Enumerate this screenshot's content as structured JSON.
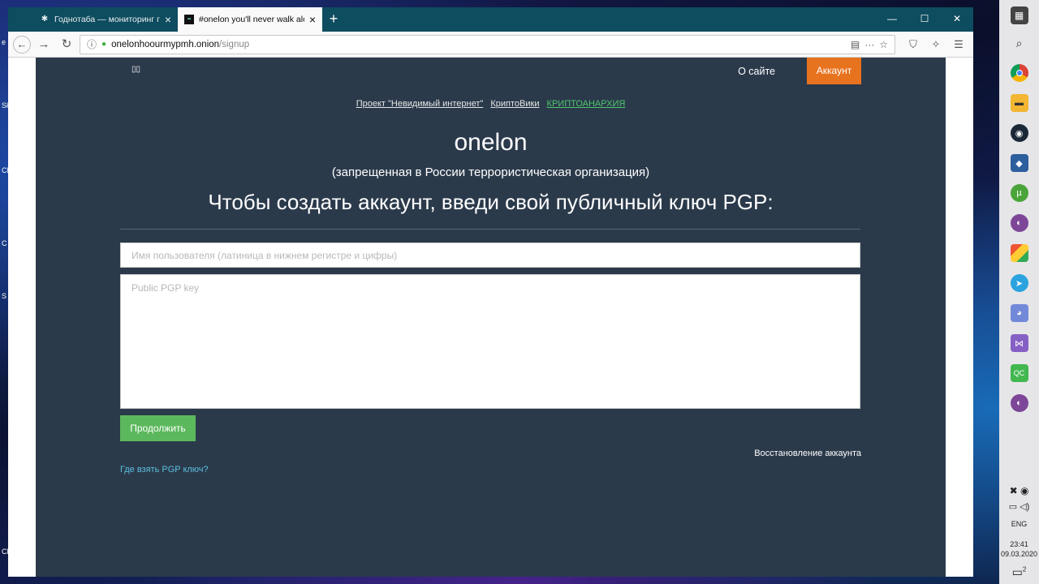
{
  "desktop": {
    "labels": [
      "e",
      "Sk",
      "Cl",
      "C",
      "S",
      "Cl"
    ]
  },
  "browser": {
    "tabs": [
      {
        "title": "Годнотаба — мониторинг год",
        "active": false
      },
      {
        "title": "#onelon you'll never walk alone",
        "active": true
      }
    ],
    "new_tab": "+",
    "window_controls": {
      "minimize": "—",
      "maximize": "☐",
      "close": "✕"
    },
    "url_host": "onelonhoourmypmh.onion",
    "url_path": "/signup"
  },
  "page": {
    "nav": {
      "logo": "▯▯",
      "about": "О сайте",
      "account": "Аккаунт"
    },
    "links": [
      {
        "label": "Проект \"Невидимый интернет\"",
        "highlight": false
      },
      {
        "label": "КриптоВики",
        "highlight": false
      },
      {
        "label": "КРИПТОАНАРХИЯ",
        "highlight": true
      }
    ],
    "title": "onelon",
    "subtitle": "(запрещенная в России террористическая организация)",
    "headline": "Чтобы создать аккаунт, введи свой публичный ключ PGP:",
    "form": {
      "username_placeholder": "Имя пользователя (латиница в нижнем регистре и цифры)",
      "username_value": "",
      "pgp_placeholder": "Public PGP key",
      "pgp_value": "",
      "continue_label": "Продолжить"
    },
    "recovery_link": "Восстановление аккаунта",
    "pgp_help_link": "Где взять PGP ключ?"
  },
  "taskbar": {
    "language": "ENG",
    "time": "23:41",
    "date": "09.03.2020",
    "notifications": "2"
  },
  "colors": {
    "page_bg": "#2b3a4b",
    "accent_orange": "#e8731f",
    "button_green": "#5cb85c",
    "link_green": "#4fc46d",
    "link_blue": "#5bc0de",
    "tabbar": "#0e4c5f"
  }
}
